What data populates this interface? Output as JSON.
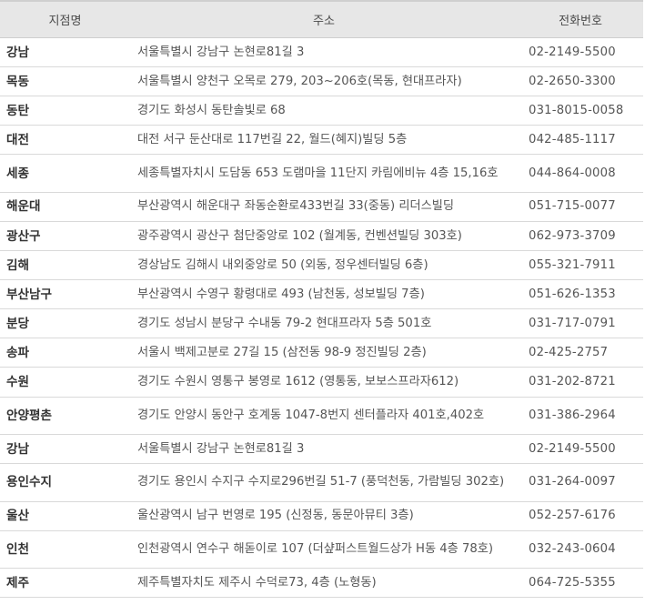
{
  "header": {
    "name": "지점명",
    "address": "주소",
    "phone": "전화번호"
  },
  "rows": [
    {
      "name": "강남",
      "address": "서울특별시 강남구 논현로81길 3",
      "phone": "02-2149-5500"
    },
    {
      "name": "목동",
      "address": "서울특별시 양천구 오목로 279, 203~206호(목동, 현대프라자)",
      "phone": "02-2650-3300"
    },
    {
      "name": "동탄",
      "address": "경기도 화성시 동탄솔빛로 68",
      "phone": "031-8015-0058"
    },
    {
      "name": "대전",
      "address": "대전 서구 둔산대로 117번길 22, 월드(혜지)빌딩 5층",
      "phone": "042-485-1117"
    },
    {
      "name": "세종",
      "address": "세종특별자치시 도담동 653 도램마을 11단지 카림에비뉴 4층 15,16호",
      "phone": "044-864-0008"
    },
    {
      "name": "해운대",
      "address": "부산광역시 해운대구 좌동순환로433번길 33(중동) 리더스빌딩",
      "phone": "051-715-0077"
    },
    {
      "name": "광산구",
      "address": "광주광역시 광산구 첨단중앙로 102 (월계동, 컨벤션빌딩 303호)",
      "phone": "062-973-3709"
    },
    {
      "name": "김해",
      "address": "경상남도 김해시 내외중앙로 50 (외동, 정우센터빌딩 6층)",
      "phone": "055-321-7911"
    },
    {
      "name": "부산남구",
      "address": "부산광역시 수영구 황령대로 493 (남천동, 성보빌딩 7층)",
      "phone": "051-626-1353"
    },
    {
      "name": "분당",
      "address": "경기도 성남시 분당구 수내동 79-2 현대프라자 5층 501호",
      "phone": "031-717-0791"
    },
    {
      "name": "송파",
      "address": "서울시 백제고분로 27길 15 (삼전동 98-9 정진빌딩 2층)",
      "phone": "02-425-2757"
    },
    {
      "name": "수원",
      "address": "경기도 수원시 영통구 봉영로 1612 (영통동, 보보스프라자612)",
      "phone": "031-202-8721"
    },
    {
      "name": "안양평촌",
      "address": "경기도 안양시 동안구 호계동 1047-8번지 센터플라자 401호,402호",
      "phone": "031-386-2964"
    },
    {
      "name": "강남",
      "address": "서울특별시 강남구 논현로81길 3",
      "phone": "02-2149-5500"
    },
    {
      "name": "용인수지",
      "address": "경기도 용인시 수지구 수지로296번길 51-7 (풍덕천동, 가람빌딩 302호)",
      "phone": "031-264-0097"
    },
    {
      "name": "울산",
      "address": "울산광역시 남구 번영로 195 (신정동, 동문아뮤티 3층)",
      "phone": "052-257-6176"
    },
    {
      "name": "인천",
      "address": "인천광역시 연수구 해돋이로 107 (더샾퍼스트월드상가 H동 4층 78호)",
      "phone": "032-243-0604"
    },
    {
      "name": "제주",
      "address": "제주특별자치도 제주시 수덕로73, 4층 (노형동)",
      "phone": "064-725-5355"
    }
  ]
}
